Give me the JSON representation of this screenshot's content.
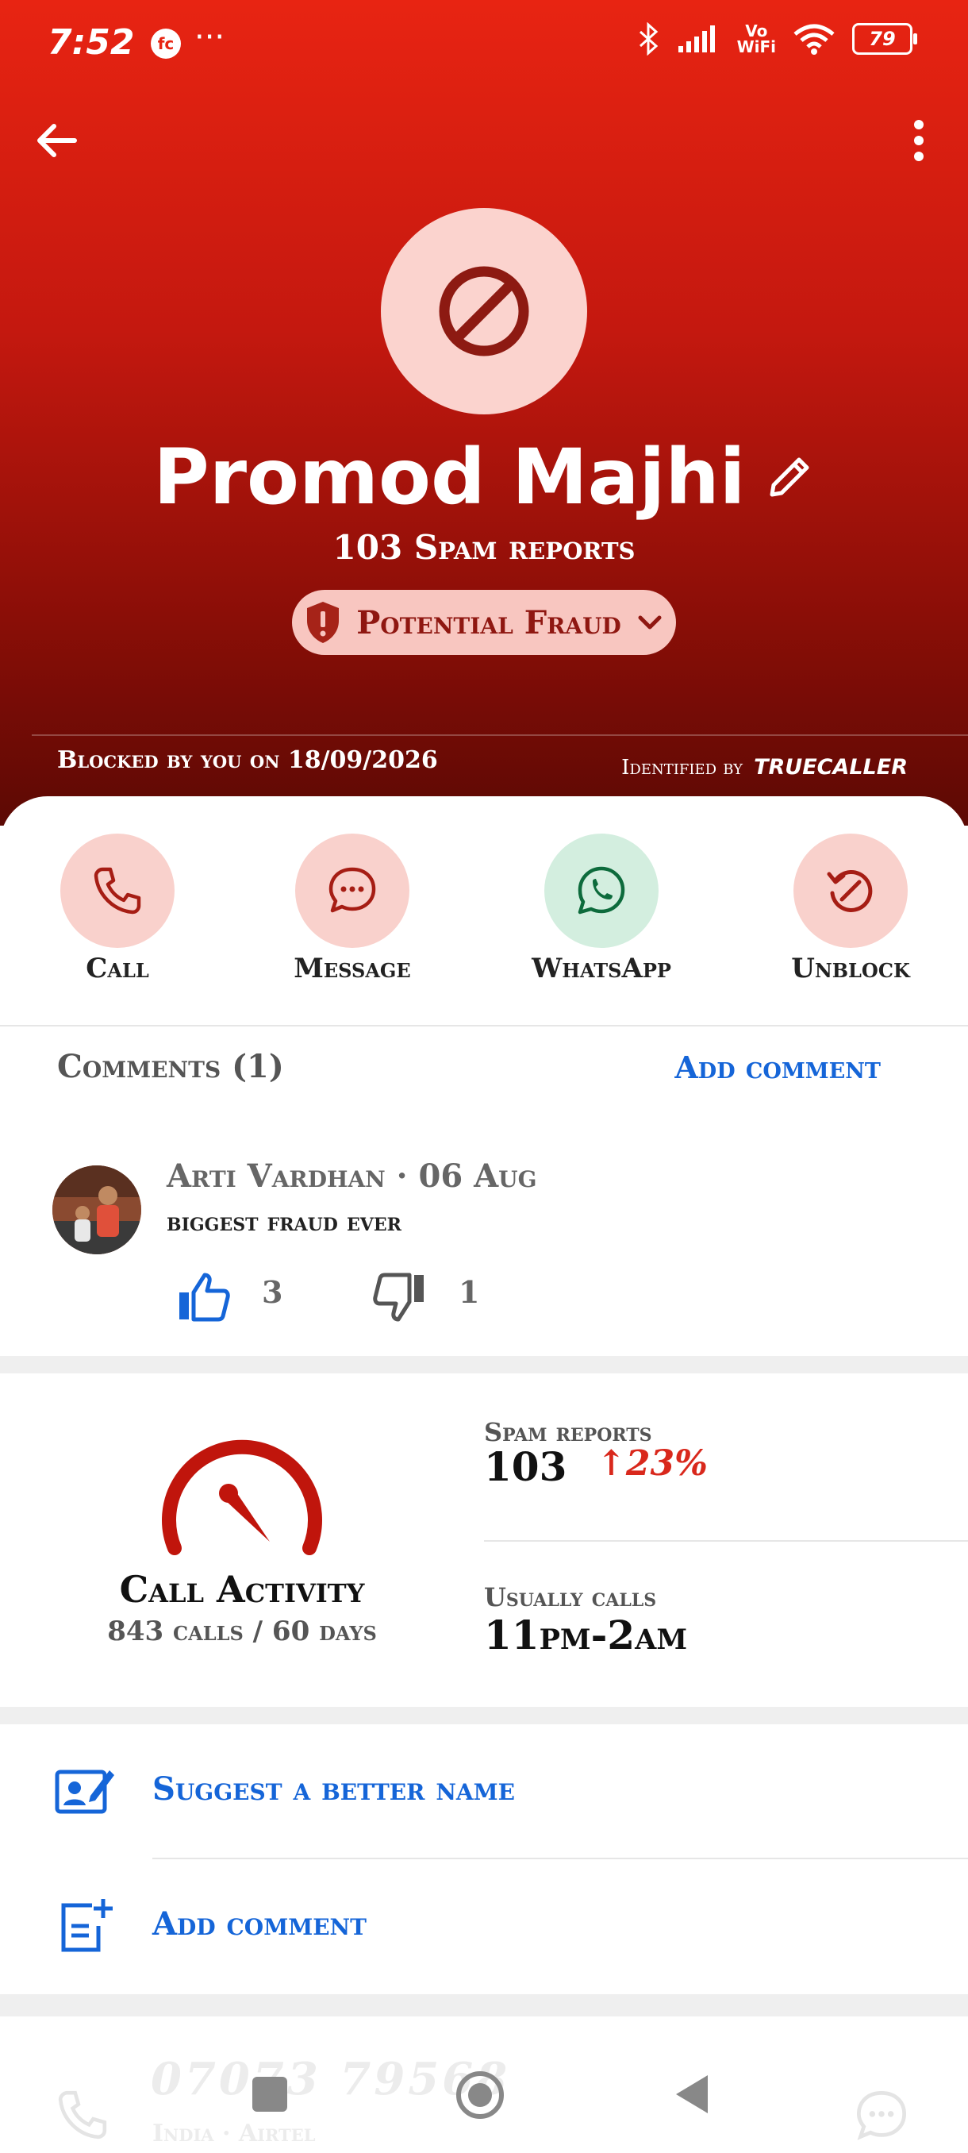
{
  "status_bar": {
    "time": "7:52",
    "fc_badge": "fc",
    "dots": "···",
    "vo_wifi_top": "Vo",
    "vo_wifi_bottom": "WiFi",
    "battery": "79"
  },
  "header": {
    "back_icon": "arrow-left-icon",
    "menu_icon": "more-vert-icon"
  },
  "profile": {
    "avatar_icon": "block-icon",
    "name": "Promod Majhi",
    "spam_reports": "103 Spam reports",
    "badge_label": "Potential Fraud",
    "blocked_label": "Blocked by you on",
    "blocked_date": "18/09/2026",
    "identified_label": "Identified by",
    "identified_brand": "truecaller"
  },
  "actions": [
    {
      "label": "Call",
      "icon": "phone-icon"
    },
    {
      "label": "Message",
      "icon": "message-icon"
    },
    {
      "label": "WhatsApp",
      "icon": "whatsapp-icon"
    },
    {
      "label": "Unblock",
      "icon": "unblock-icon"
    }
  ],
  "comments": {
    "title": "Comments (1)",
    "add_label": "Add comment",
    "items": [
      {
        "author": "Arti Vardhan · 06 Aug",
        "text": "biggest fraud ever",
        "likes": "3",
        "dislikes": "1"
      }
    ]
  },
  "activity": {
    "title": "Call Activity",
    "subtitle": "843 calls / 60 days",
    "spam_label": "Spam reports",
    "spam_value": "103",
    "spam_trend": "↑23%",
    "usual_label": "Usually calls",
    "usual_value": "11pm-2am"
  },
  "links": {
    "suggest_name": "Suggest a better name",
    "add_comment": "Add comment"
  },
  "footer": {
    "number": "07073 79568",
    "carrier": "India · Airtel"
  },
  "colors": {
    "accent": "#e82412",
    "link": "#1565d8",
    "whatsapp_bg": "#d3eedf",
    "action_bg": "#f9d1cc"
  }
}
